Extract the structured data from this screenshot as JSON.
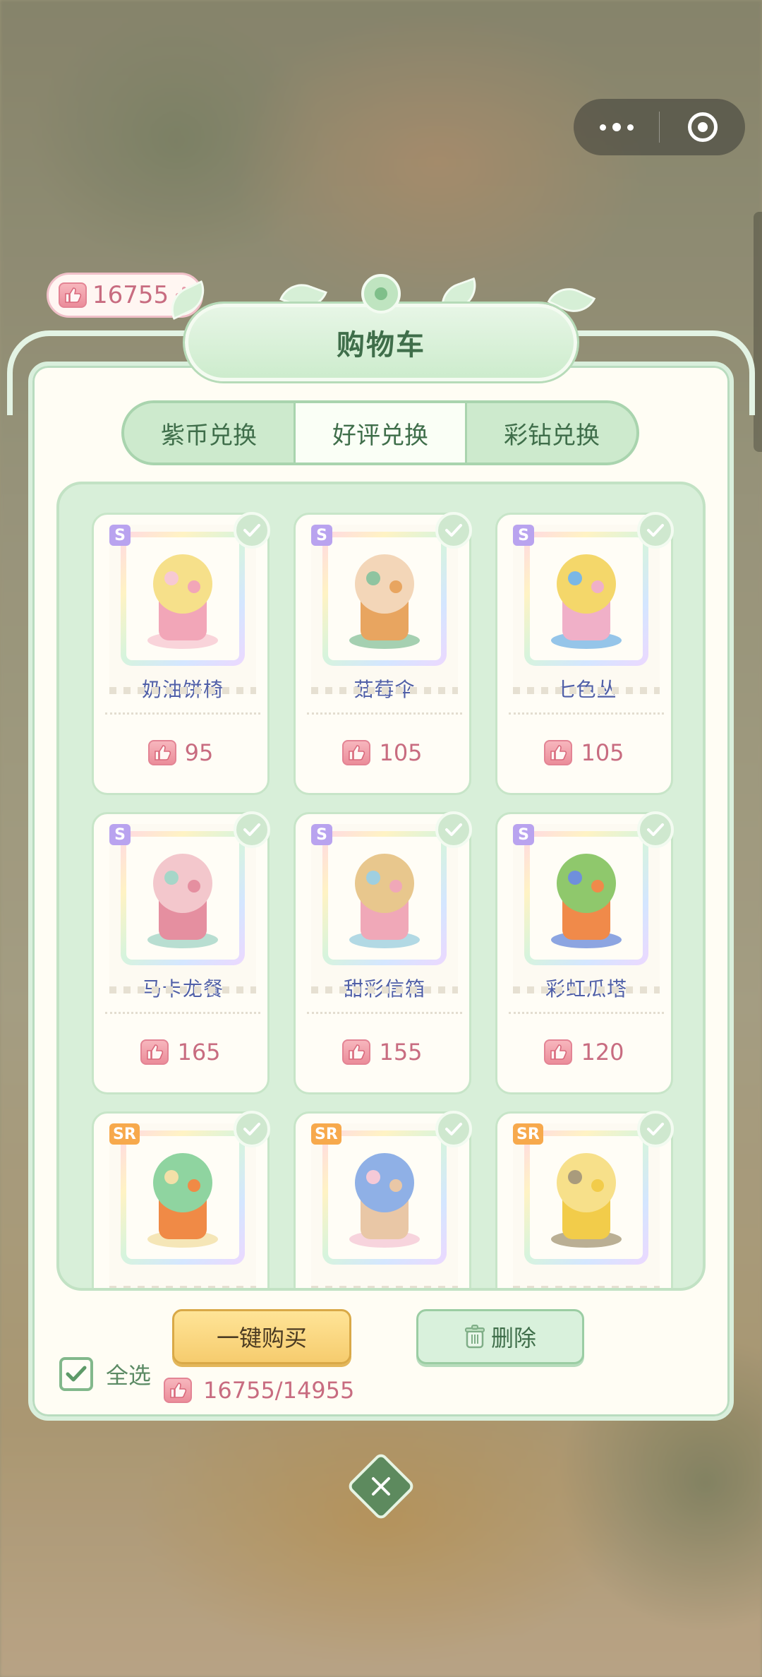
{
  "capsule": {
    "more_icon": "more-dots-icon",
    "close_icon": "target-icon"
  },
  "currency": {
    "amount": "16755",
    "icon": "thumbs-up-icon",
    "add_icon": "plus-icon"
  },
  "title": "购物车",
  "tabs": [
    {
      "label": "紫币兑换",
      "active": false
    },
    {
      "label": "好评兑换",
      "active": true
    },
    {
      "label": "彩钻兑换",
      "active": false
    }
  ],
  "items": [
    {
      "name": "奶油饼椅",
      "rarity": "S",
      "price": "95",
      "selected": true
    },
    {
      "name": "菇莓伞",
      "rarity": "S",
      "price": "105",
      "selected": true
    },
    {
      "name": "七色丛",
      "rarity": "S",
      "price": "105",
      "selected": true
    },
    {
      "name": "马卡龙餐",
      "rarity": "S",
      "price": "165",
      "selected": true
    },
    {
      "name": "甜彩信箱",
      "rarity": "S",
      "price": "155",
      "selected": true
    },
    {
      "name": "彩虹瓜塔",
      "rarity": "S",
      "price": "120",
      "selected": true
    },
    {
      "name": "",
      "rarity": "SR",
      "price": "",
      "selected": true
    },
    {
      "name": "",
      "rarity": "SR",
      "price": "",
      "selected": true
    },
    {
      "name": "",
      "rarity": "SR",
      "price": "",
      "selected": true
    }
  ],
  "footer": {
    "select_all_label": "全选",
    "buy_label": "一键购买",
    "delete_label": "删除",
    "total": "16755/14955"
  },
  "colors": {
    "accent_green": "#5d8a5e",
    "price_pink": "#c86c80",
    "buy_yellow": "#f6cc6e"
  }
}
